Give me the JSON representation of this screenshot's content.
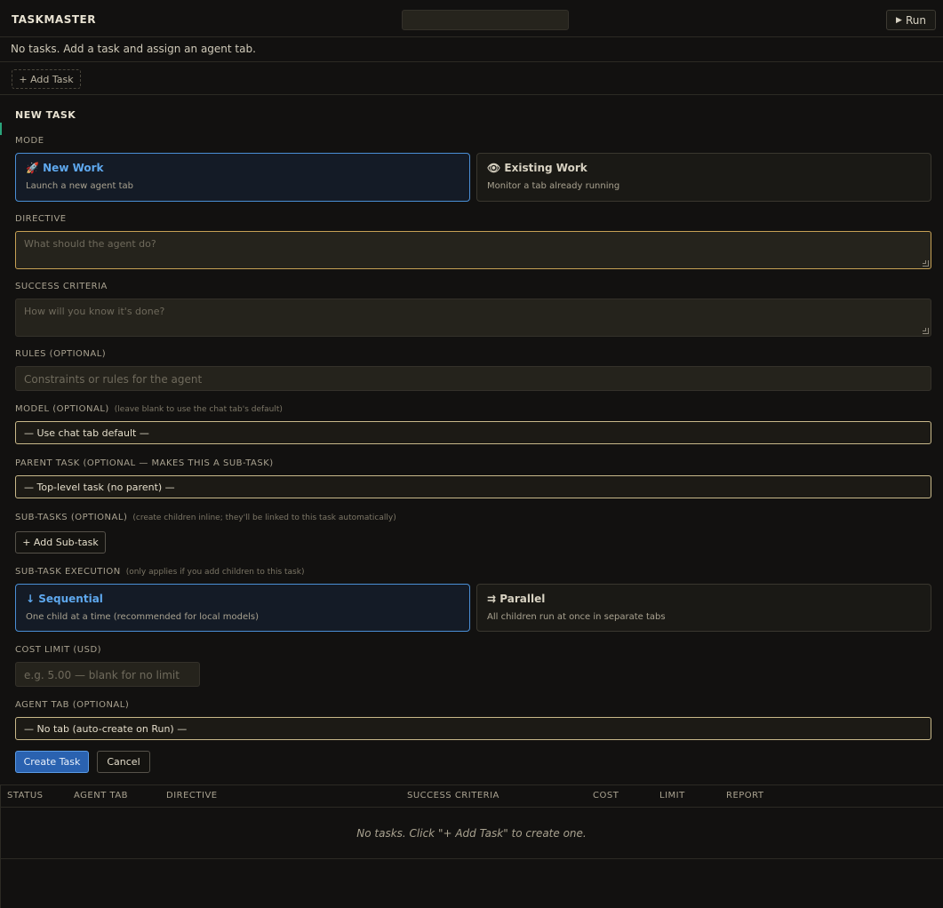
{
  "app": {
    "title": "TASKMASTER",
    "run_label": "Run",
    "run_icon": "▶"
  },
  "status": "No tasks. Add a task and assign an agent tab.",
  "toolbar": {
    "add_task_label": "+ Add Task"
  },
  "form": {
    "title": "NEW TASK",
    "mode": {
      "label": "MODE",
      "options": [
        {
          "icon": "🚀",
          "title": "New Work",
          "desc": "Launch a new agent tab",
          "selected": true
        },
        {
          "icon": "👁",
          "title": "Existing Work",
          "desc": "Monitor a tab already running",
          "selected": false
        }
      ]
    },
    "directive": {
      "label": "DIRECTIVE",
      "placeholder": "What should the agent do?"
    },
    "success": {
      "label": "SUCCESS CRITERIA",
      "placeholder": "How will you know it's done?"
    },
    "rules": {
      "label": "RULES (OPTIONAL)",
      "placeholder": "Constraints or rules for the agent"
    },
    "model": {
      "label": "MODEL (OPTIONAL)",
      "hint": "(leave blank to use the chat tab's default)",
      "value": "— Use chat tab default —"
    },
    "parent": {
      "label": "PARENT TASK (OPTIONAL — MAKES THIS A SUB-TASK)",
      "value": "— Top-level task (no parent) —"
    },
    "subtasks": {
      "label": "SUB-TASKS (OPTIONAL)",
      "hint": "(create children inline; they'll be linked to this task automatically)",
      "add_label": "+ Add Sub-task"
    },
    "execution": {
      "label": "SUB-TASK EXECUTION",
      "hint": "(only applies if you add children to this task)",
      "options": [
        {
          "icon": "↓",
          "title": "Sequential",
          "desc": "One child at a time (recommended for local models)",
          "selected": true
        },
        {
          "icon": "⇉",
          "title": "Parallel",
          "desc": "All children run at once in separate tabs",
          "selected": false
        }
      ]
    },
    "cost": {
      "label": "COST LIMIT (USD)",
      "placeholder": "e.g. 5.00 — blank for no limit"
    },
    "agent_tab": {
      "label": "AGENT TAB (OPTIONAL)",
      "value": "— No tab (auto-create on Run) —"
    },
    "create_label": "Create Task",
    "cancel_label": "Cancel"
  },
  "table": {
    "columns": [
      "STATUS",
      "AGENT TAB",
      "DIRECTIVE",
      "SUCCESS CRITERIA",
      "COST",
      "LIMIT",
      "REPORT"
    ],
    "empty_text": "No tasks. Click \"+ Add Task\" to create one."
  },
  "colors": {
    "accent": "#4a8fd6",
    "focus": "#c7a155",
    "background": "#121110"
  }
}
